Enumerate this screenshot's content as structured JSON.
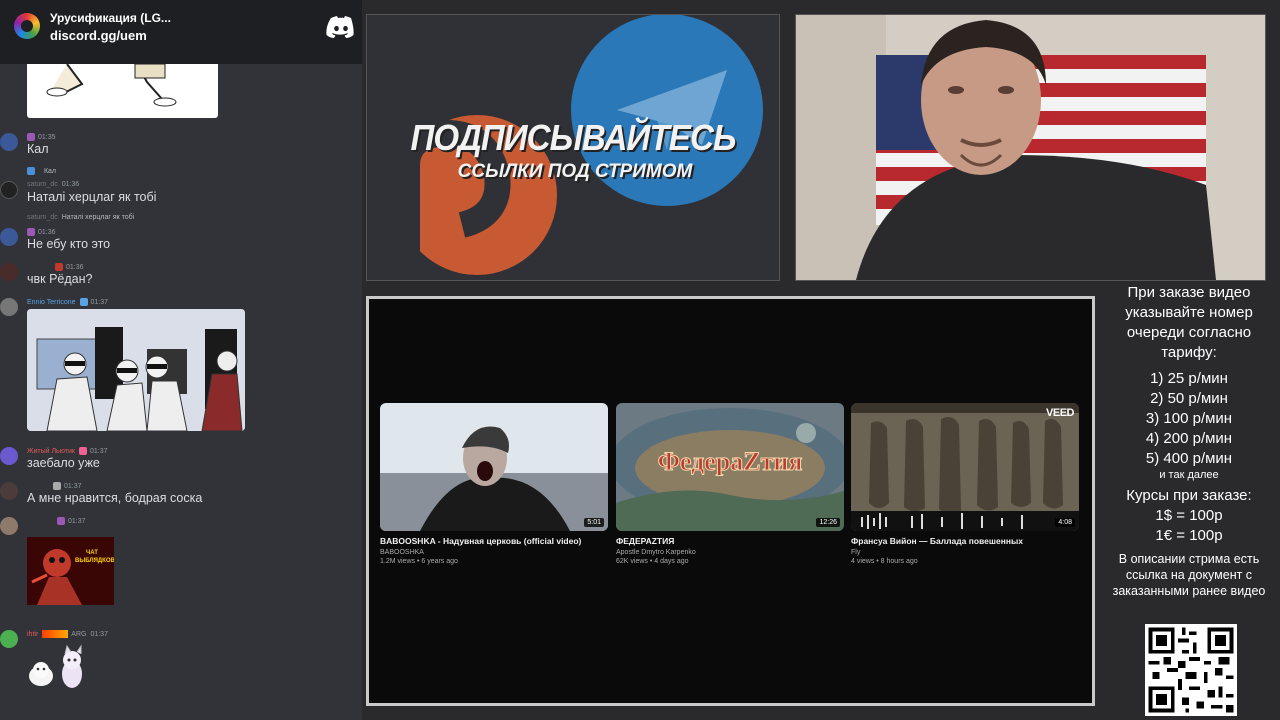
{
  "discord": {
    "server_name": "Урусификация (LG...",
    "invite": "discord.gg/uem",
    "messages": [
      {
        "time": "01:35",
        "text": "Кал"
      },
      {
        "reply_text": "Кал",
        "user": "saturn_dc",
        "time": "01:36",
        "text": "Наталі херцлаг як тобі"
      },
      {
        "reply_user": "saturn_dc",
        "reply_text": "Наталі херцлаг як тобі",
        "time": "01:36",
        "text": "Не ебу кто это"
      },
      {
        "time": "01:36",
        "text": "чвк Рёдан?"
      },
      {
        "user": "Ennio Terricone",
        "time": "01:37"
      },
      {
        "user": "Житый Льютик",
        "time": "01:37",
        "text": "заебало уже"
      },
      {
        "time": "01:37",
        "text": "А мне нравится, бодрая соска"
      },
      {
        "time": "01:37",
        "image_caption": "ЧАТ ВЫБЛЯДКОВ"
      },
      {
        "user": "ihtir",
        "tag": "ARG",
        "time": "01:37"
      }
    ]
  },
  "banner": {
    "title": "ПОДПИСЫВАЙТЕСЬ",
    "subtitle": "ССЫЛКИ ПОД СТРИМОМ"
  },
  "youtube": {
    "videos": [
      {
        "title": "BABOOSHKA - Надувная церковь (official video)",
        "channel": "BABOOSHKA",
        "stats": "1.2M views • 6 years ago",
        "duration": "5:01"
      },
      {
        "title": "ФЕДЕРАZТИЯ",
        "channel": "Apostle Dmytro Karpenko",
        "stats": "62K views • 4 days ago",
        "duration": "12:26",
        "thumb_text": "ФедераZтия"
      },
      {
        "title": "Франсуа Вийон — Баллада повешенных",
        "channel": "Fly",
        "stats": "4 views • 8 hours ago",
        "duration": "4:08",
        "watermark": "VEED"
      }
    ]
  },
  "info": {
    "heading": "При заказе видео указывайте номер очереди согласно тарифу:",
    "tariffs": [
      "1) 25 р/мин",
      "2) 50 р/мин",
      "3) 100 р/мин",
      "4) 200 р/мин",
      "5) 400 р/мин"
    ],
    "etc": "и так далее",
    "rates_title": "Курсы при заказе:",
    "rates": [
      "1$ = 100р",
      "1€ = 100р"
    ],
    "note": "В описании стрима есть ссылка на документ с заказанными ранее видео"
  },
  "colors": {
    "discord_bg": "#313338",
    "discord_header": "#1e1f22",
    "username_blue": "#5aa2e6",
    "username_red": "#e65a5a",
    "youtube_bg": "#0a0a0a",
    "patreon_orange": "#c85a33",
    "telegram_blue": "#2b78b8"
  }
}
